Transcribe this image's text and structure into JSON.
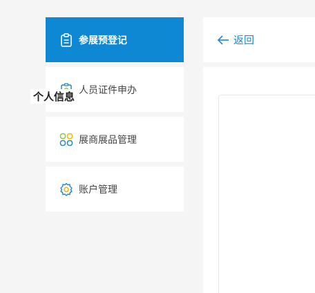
{
  "sidebar": {
    "items": [
      {
        "label": "参展预登记",
        "icon": "clipboard-icon",
        "active": true
      },
      {
        "label": "人员证件申办",
        "icon": "id-badge-icon",
        "active": false
      },
      {
        "label": "展商展品管理",
        "icon": "grid-apps-icon",
        "active": false
      },
      {
        "label": "账户管理",
        "icon": "gear-icon",
        "active": false
      }
    ]
  },
  "header": {
    "back_label": "返回",
    "back_icon": "arrow-left-icon"
  },
  "form": {
    "section_title": "个人信息"
  },
  "colors": {
    "accent": "#0f88d3",
    "link": "#1e88c8",
    "icon_green": "#8cc63f",
    "icon_yellow": "#f5b400"
  }
}
